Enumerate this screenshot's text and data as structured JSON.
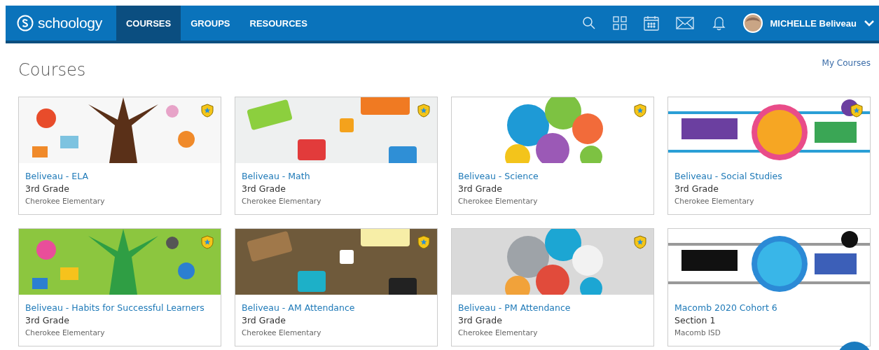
{
  "header": {
    "logo": "schoology",
    "nav": [
      {
        "label": "COURSES",
        "selected": true
      },
      {
        "label": "GROUPS",
        "selected": false
      },
      {
        "label": "RESOURCES",
        "selected": false
      }
    ],
    "user": "MICHELLE Beliveau"
  },
  "page": {
    "title": "Courses",
    "link": "My Courses"
  },
  "courses": [
    {
      "title": "Beliveau - ELA",
      "section": "3rd Grade",
      "school": "Cherokee Elementary",
      "admin_badge": true
    },
    {
      "title": "Beliveau - Math",
      "section": "3rd Grade",
      "school": "Cherokee Elementary",
      "admin_badge": true
    },
    {
      "title": "Beliveau - Science",
      "section": "3rd Grade",
      "school": "Cherokee Elementary",
      "admin_badge": true
    },
    {
      "title": "Beliveau - Social Studies",
      "section": "3rd Grade",
      "school": "Cherokee Elementary",
      "admin_badge": true
    },
    {
      "title": "Beliveau - Habits for Successful Learners",
      "section": "3rd Grade",
      "school": "Cherokee Elementary",
      "admin_badge": true
    },
    {
      "title": "Beliveau - AM Attendance",
      "section": "3rd Grade",
      "school": "Cherokee Elementary",
      "admin_badge": true
    },
    {
      "title": "Beliveau - PM Attendance",
      "section": "3rd Grade",
      "school": "Cherokee Elementary",
      "admin_badge": true
    },
    {
      "title": "Macomb 2020 Cohort 6",
      "section": "Section 1",
      "school": "Macomb ISD",
      "admin_badge": false
    }
  ]
}
